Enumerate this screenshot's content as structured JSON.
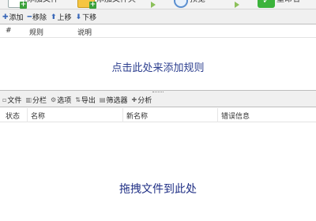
{
  "top_toolbar": {
    "buttons": [
      {
        "label": "添加文件",
        "icon": "file-add-icon"
      },
      {
        "label": "添加文件夹",
        "icon": "folder-add-icon"
      },
      {
        "label": "",
        "icon": "arrow-right-icon"
      },
      {
        "label": "预览",
        "icon": "magnifier-icon"
      },
      {
        "label": "",
        "icon": "arrow-right-icon"
      },
      {
        "label": "重命名",
        "icon": "checkmark-icon"
      }
    ]
  },
  "rule_toolbar": {
    "add": "添加",
    "remove": "移除",
    "move_up": "上移",
    "move_down": "下移"
  },
  "rules_panel": {
    "columns": [
      "#",
      "规则",
      "说明"
    ],
    "hint": "点击此处来添加规则"
  },
  "file_toolbar": {
    "files": "文件",
    "columns": "分栏",
    "options": "选项",
    "export": "导出",
    "filter": "筛选器",
    "analyze": "分析"
  },
  "files_panel": {
    "columns": [
      "状态",
      "名称",
      "新名称",
      "错误信息"
    ],
    "hint": "拖拽文件到此处"
  }
}
